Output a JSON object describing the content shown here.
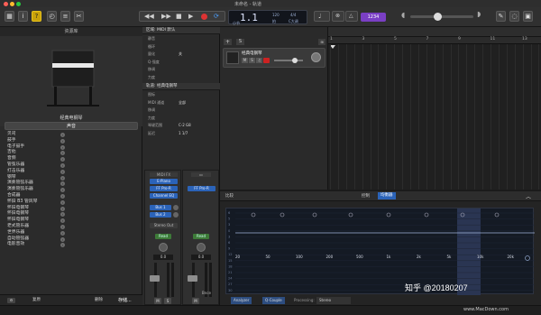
{
  "window": {
    "title": "未命名 - 轨道"
  },
  "toolbar": {
    "help_label": "?",
    "tempo": "120",
    "tempo_unit": "拍",
    "position": "1.1",
    "time_sig": "4/4",
    "key": "C大调",
    "bar_label": "小节",
    "counter": "1234"
  },
  "library": {
    "title": "资源库",
    "instrument_name": "经典电钢琴",
    "search": "声音",
    "items": [
      "贝司",
      "鼓手",
      "电子鼓手",
      "吉他",
      "音频",
      "管弦乐器",
      "打击乐器",
      "钢琴",
      "演奏管弦乐器",
      "演奏管弦乐器",
      "合成器",
      "怀旧 B3 管风琴",
      "怀旧电钢琴",
      "怀旧电钢琴",
      "怀旧电钢琴",
      "老式管乐器",
      "世界乐器",
      "自动管弦器",
      "电影音效"
    ],
    "bottom_left": "复原",
    "bottom_mid": "删除",
    "bottom_right": "存储..."
  },
  "inspector": {
    "region_header": "区域: MIDI 默认",
    "region_rows": [
      [
        "静音",
        ""
      ],
      [
        "循环",
        ""
      ],
      [
        "量化",
        "关"
      ],
      [
        "Q-强度",
        ""
      ],
      [
        "移调",
        ""
      ],
      [
        "力度",
        ""
      ]
    ],
    "track_header": "轨道: 经典电钢琴",
    "track_rows": [
      [
        "图标",
        ""
      ],
      [
        "MIDI 通道",
        "全部"
      ],
      [
        "移调",
        ""
      ],
      [
        "力度",
        ""
      ],
      [
        "琴键范围",
        "C-2 G8"
      ],
      [
        "延迟",
        "1 1/7"
      ]
    ],
    "strip1": {
      "label": "MIDI FX",
      "slots": [
        "E-Piano",
        "FF Pro-R",
        "Channel EQ"
      ],
      "sends": [
        "Bus 1",
        "Bus 2"
      ],
      "out": "Stereo Out",
      "mode": "Read",
      "vol": "0.0",
      "name": "经典电钢琴"
    },
    "strip2": {
      "label": "",
      "slots": [
        "FF Pro-R"
      ],
      "sends": [],
      "out": "",
      "mode": "Read",
      "vol": "0.0",
      "name": "Stereo Out",
      "bnce": "Bnce"
    }
  },
  "tracks": {
    "menu": [
      "编辑",
      "功能",
      "显示"
    ],
    "add": "+",
    "solo": "S",
    "track_name": "经典电钢琴"
  },
  "ruler": {
    "labels": [
      "1",
      "3",
      "5",
      "7",
      "9",
      "11",
      "13"
    ]
  },
  "eq": {
    "tab_left": "比较",
    "tab_control": "控制",
    "tab_eq": "均衡器",
    "freq_labels": [
      "20",
      "50",
      "100",
      "200",
      "500",
      "1k",
      "2k",
      "5k",
      "10k",
      "20k"
    ],
    "db_labels": [
      "6",
      "5",
      "3",
      "0",
      "3",
      "6",
      "9",
      "12",
      "15",
      "18",
      "21",
      "24",
      "27",
      "30"
    ],
    "analyzer": "Analyzer",
    "q_couple": "Q-Couple",
    "processing": "Processing:",
    "stereo": "Stereo"
  },
  "watermark": "www.MacDown.com",
  "zhihu": "知乎 @20180207"
}
